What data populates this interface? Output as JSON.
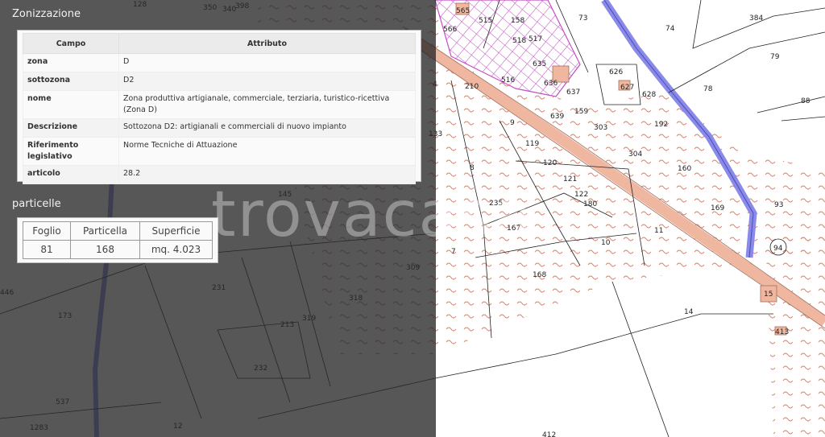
{
  "zonizzazione": {
    "title": "Zonizzazione",
    "headers": {
      "campo": "Campo",
      "attributo": "Attributo"
    },
    "rows": [
      {
        "campo": "zona",
        "attributo": "D"
      },
      {
        "campo": "sottozona",
        "attributo": "D2"
      },
      {
        "campo": "nome",
        "attributo": "Zona produttiva artigianale, commerciale, terziaria, turistico-ricettiva (Zona D)"
      },
      {
        "campo": "Descrizione",
        "attributo": "Sottozona D2: artigianali e commerciali di nuovo impianto"
      },
      {
        "campo": "Riferimento legislativo",
        "attributo": "Norme Tecniche di Attuazione"
      },
      {
        "campo": "articolo",
        "attributo": "28.2"
      }
    ]
  },
  "particelle": {
    "title": "particelle",
    "headers": {
      "foglio": "Foglio",
      "particella": "Particella",
      "superficie": "Superficie"
    },
    "row": {
      "foglio": "81",
      "particella": "168",
      "superficie": "mq. 4.023"
    }
  },
  "watermark": "trovacasa",
  "map": {
    "colors": {
      "hatch": "#d9826d",
      "road": "#f0b7a0",
      "canal": "#8a8ae8",
      "zone_d": "#c24ec4",
      "line": "#222222"
    },
    "parcel_labels": [
      "128",
      "350",
      "340",
      "398",
      "565",
      "515",
      "158",
      "73",
      "384",
      "566",
      "518",
      "517",
      "74",
      "79",
      "635",
      "626",
      "210",
      "516",
      "636",
      "637",
      "627",
      "628",
      "78",
      "88",
      "4",
      "639",
      "159",
      "9",
      "303",
      "192",
      "133",
      "119",
      "304",
      "120",
      "160",
      "8",
      "121",
      "122",
      "169",
      "93",
      "145",
      "235",
      "180",
      "167",
      "10",
      "11",
      "94",
      "309",
      "7",
      "168",
      "15",
      "446",
      "231",
      "318",
      "173",
      "213",
      "319",
      "14",
      "413",
      "232",
      "537",
      "1283",
      "12",
      "412"
    ]
  }
}
